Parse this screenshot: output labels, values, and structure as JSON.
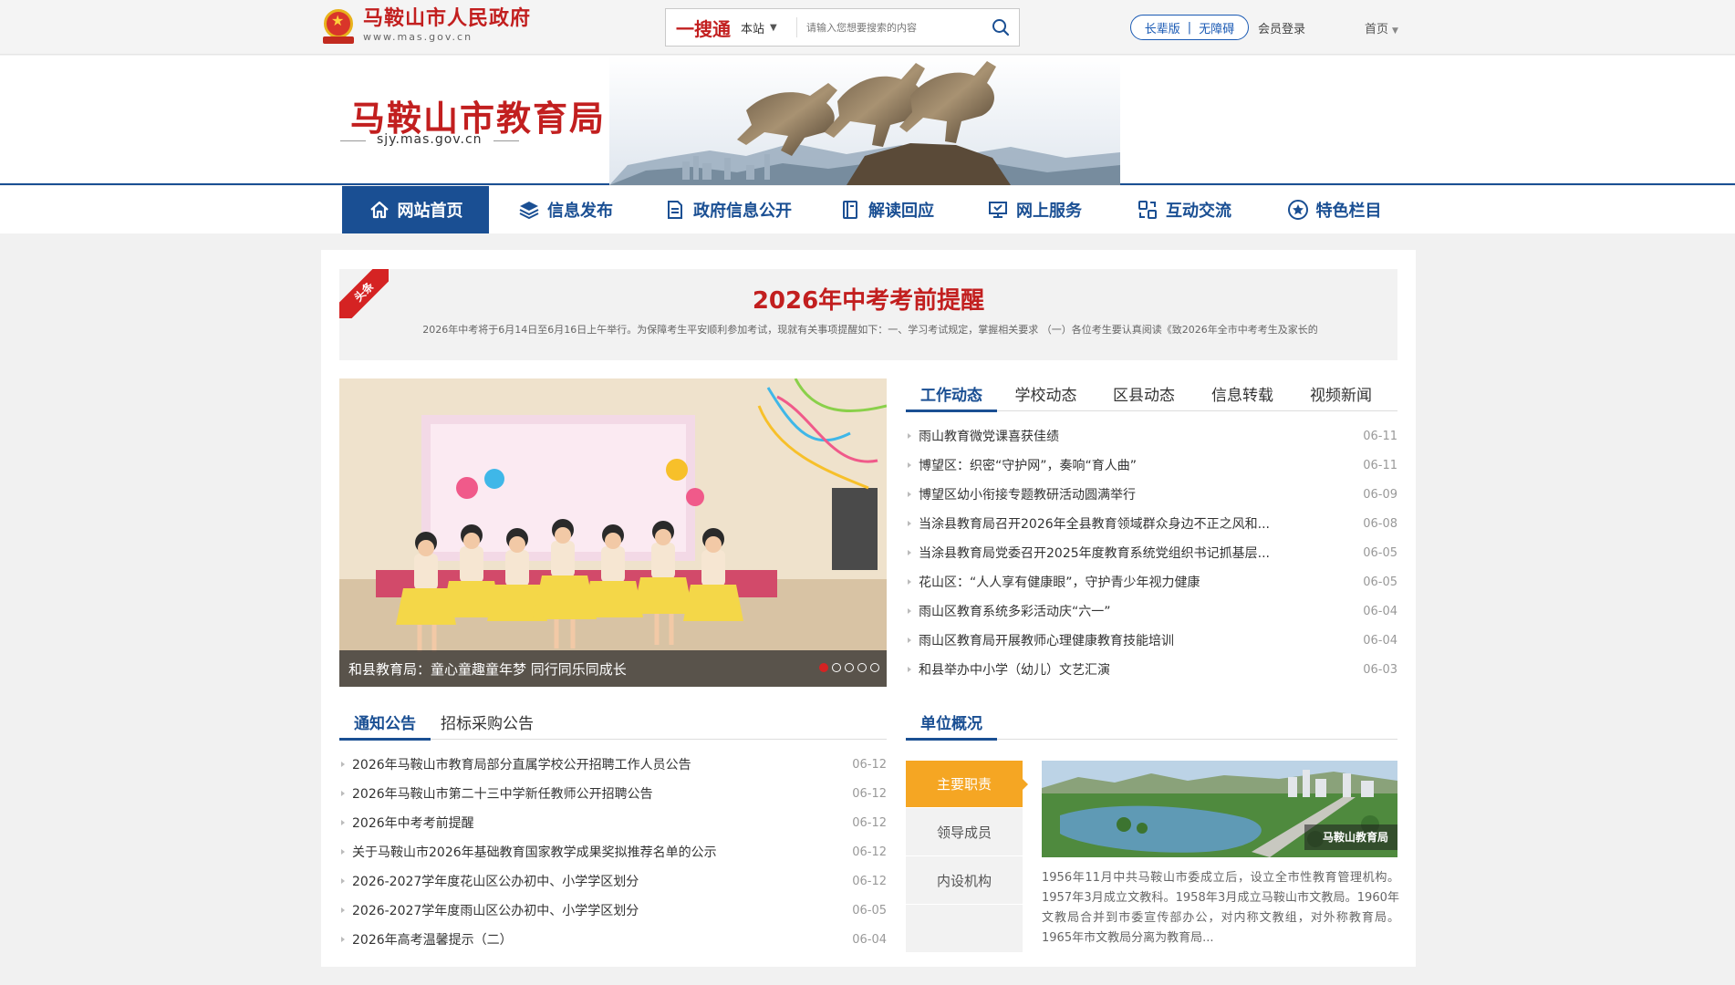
{
  "topbar": {
    "gov_name": "马鞍山市人民政府",
    "gov_url": "www.mas.gov.cn",
    "search": {
      "brand": "一搜通",
      "scope": "本站",
      "placeholder": "请输入您想要搜索的内容"
    },
    "mode_elderly": "长辈版",
    "mode_accessible": "无障碍",
    "login": "会员登录",
    "home_dropdown": "首页"
  },
  "banner": {
    "title": "马鞍山市教育局",
    "url": "sjy.mas.gov.cn"
  },
  "nav": {
    "items": [
      {
        "label": "网站首页",
        "icon": "home-icon"
      },
      {
        "label": "信息发布",
        "icon": "layers-icon"
      },
      {
        "label": "政府信息公开",
        "icon": "document-icon"
      },
      {
        "label": "解读回应",
        "icon": "book-icon"
      },
      {
        "label": "网上服务",
        "icon": "monitor-icon"
      },
      {
        "label": "互动交流",
        "icon": "interaction-icon"
      },
      {
        "label": "特色栏目",
        "icon": "star-circle-icon"
      }
    ]
  },
  "headline": {
    "ribbon": "头条",
    "title": "2026年中考考前提醒",
    "summary": "2026年中考将于6月14日至6月16日上午举行。为保障考生平安顺利参加考试，现就有关事项提醒如下：一、学习考试规定，掌握相关要求 （一）各位考生要认真阅读《致2026年全市中考考生及家长的"
  },
  "slider": {
    "caption": "和县教育局：童心童趣童年梦 同行同乐同成长",
    "dots": 5,
    "active_dot": 1
  },
  "news": {
    "tabs": [
      "工作动态",
      "学校动态",
      "区县动态",
      "信息转载",
      "视频新闻"
    ],
    "items": [
      {
        "title": "雨山教育微党课喜获佳绩",
        "date": "06-11"
      },
      {
        "title": "博望区：织密“守护网”，奏响“育人曲”",
        "date": "06-11"
      },
      {
        "title": "博望区幼小衔接专题教研活动圆满举行",
        "date": "06-09"
      },
      {
        "title": "当涂县教育局召开2026年全县教育领域群众身边不正之风和...",
        "date": "06-08"
      },
      {
        "title": "当涂县教育局党委召开2025年度教育系统党组织书记抓基层...",
        "date": "06-05"
      },
      {
        "title": "花山区：“人人享有健康眼”，守护青少年视力健康",
        "date": "06-05"
      },
      {
        "title": "雨山区教育系统多彩活动庆“六一”",
        "date": "06-04"
      },
      {
        "title": "雨山区教育局开展教师心理健康教育技能培训",
        "date": "06-04"
      },
      {
        "title": "和县举办中小学（幼儿）文艺汇演",
        "date": "06-03"
      }
    ]
  },
  "notices": {
    "tabs": [
      "通知公告",
      "招标采购公告"
    ],
    "items": [
      {
        "title": "2026年马鞍山市教育局部分直属学校公开招聘工作人员公告",
        "date": "06-12"
      },
      {
        "title": "2026年马鞍山市第二十三中学新任教师公开招聘公告",
        "date": "06-12"
      },
      {
        "title": "2026年中考考前提醒",
        "date": "06-12"
      },
      {
        "title": "关于马鞍山市2026年基础教育国家教学成果奖拟推荐名单的公示",
        "date": "06-12"
      },
      {
        "title": "2026-2027学年度花山区公办初中、小学学区划分",
        "date": "06-12"
      },
      {
        "title": "2026-2027学年度雨山区公办初中、小学学区划分",
        "date": "06-05"
      },
      {
        "title": "2026年高考温馨提示（二）",
        "date": "06-04"
      }
    ]
  },
  "org": {
    "tab": "单位概况",
    "menu": [
      "主要职责",
      "领导成员",
      "内设机构"
    ],
    "photo_tag": "马鞍山教育局",
    "description": "1956年11月中共马鞍山市委成立后，设立全市性教育管理机构。1957年3月成立文教科。1958年3月成立马鞍山市文教局。1960年文教局合并到市委宣传部办公，对内称文教组，对外称教育局。1965年市文教局分离为教育局..."
  },
  "colors": {
    "brand_blue": "#1a4f93",
    "brand_red": "#c21f1f",
    "accent_orange": "#f5a623"
  }
}
